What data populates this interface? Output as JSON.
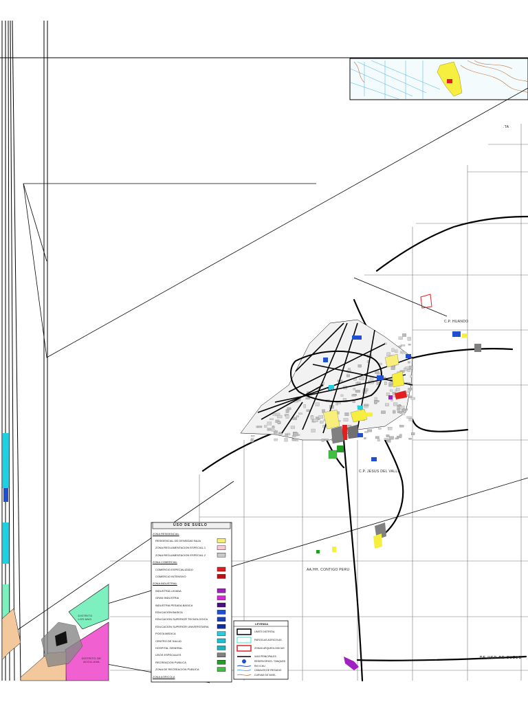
{
  "map": {
    "title": "USO DE SUELO",
    "labels": {
      "cp_huando": "C.P. HUANDO",
      "cp_jesus_del_valle": "C.P. JESUS DEL VALLE",
      "aahh_contigo_peru": "AA.HH. CONTIGO PERU",
      "distrito_acollana": "DISTRITO DE ACOLLANA",
      "distrito_los_ang": "DISTRITO LOS ANG.",
      "bottom_right": "DE USO DE SUELO",
      "top_right_fragment": ".TA"
    },
    "zoning_legend": [
      {
        "label": "ZONA RESIDENCIAL",
        "color": "#ffffff"
      },
      {
        "label": "RESIDENCIAL DE DENSIDAD BAJA",
        "color": "#f7ef7a"
      },
      {
        "label": "ZONA REGLAMENTACION ESPECIAL 1",
        "color": "#f8c7d8"
      },
      {
        "label": "ZONA REGLAMENTACION ESPECIAL 2",
        "color": "#c8c8c8"
      },
      {
        "label": "ZONA COMERCIAL",
        "color": "#ffffff"
      },
      {
        "label": "COMERCIO ESPECIALIZADO",
        "color": "#e31e1e"
      },
      {
        "label": "COMERCIO INTENSIVO",
        "color": "#b81414"
      },
      {
        "label": "ZONA INDUSTRIAL",
        "color": "#ffffff"
      },
      {
        "label": "INDUSTRIA LIVIANA",
        "color": "#a020c0"
      },
      {
        "label": "GRAN INDUSTRIA",
        "color": "#e020e0"
      },
      {
        "label": "INDUSTRIA PESADA BASICA",
        "color": "#4a1080"
      },
      {
        "label": "EDUCACION BASICA",
        "color": "#2050d0"
      },
      {
        "label": "EDUCACION SUPERIOR TECNOLOGICA",
        "color": "#1a40b0"
      },
      {
        "label": "EDUCACION SUPERIOR UNIVERSITARIA",
        "color": "#1030a0"
      },
      {
        "label": "POSTA MEDICA",
        "color": "#20d0e0"
      },
      {
        "label": "CENTRO DE SALUD",
        "color": "#20c0d0"
      },
      {
        "label": "HOSPITAL GENERAL",
        "color": "#20b0c0"
      },
      {
        "label": "USOS ESPECIALES",
        "color": "#808080"
      },
      {
        "label": "RECREACION PUBLICA",
        "color": "#20a020"
      },
      {
        "label": "ZONA DE RECREACION PUBLICA",
        "color": "#40c040"
      },
      {
        "label": "ZONA AGRICOLA",
        "color": "#ffffff"
      }
    ],
    "symbol_legend": {
      "title": "LEYENDA",
      "items": [
        {
          "label": "LIMITE DISTRITAL"
        },
        {
          "label": "PARCELAS AGRICOLAS"
        },
        {
          "label": "ZONAS ARQUEOLOGICAS"
        },
        {
          "label": "VIAS PRINCIPALES"
        },
        {
          "label": "RESERVORIOS / TANQUES"
        },
        {
          "label": "RIO ICHU"
        },
        {
          "label": "CANALES DE REGADIO"
        },
        {
          "label": "CURVAS DE NIVEL"
        }
      ]
    },
    "colors": {
      "road": "#000000",
      "grid": "#555555",
      "residential": "#f7ef7a",
      "education": "#2050d0",
      "commerce": "#e31e1e",
      "recreation": "#20a020",
      "special": "#808080",
      "distrito_acollana": "#f060d0",
      "distrito_los_ang": "#7ef0c0",
      "terrain": "#f2c89c"
    }
  }
}
